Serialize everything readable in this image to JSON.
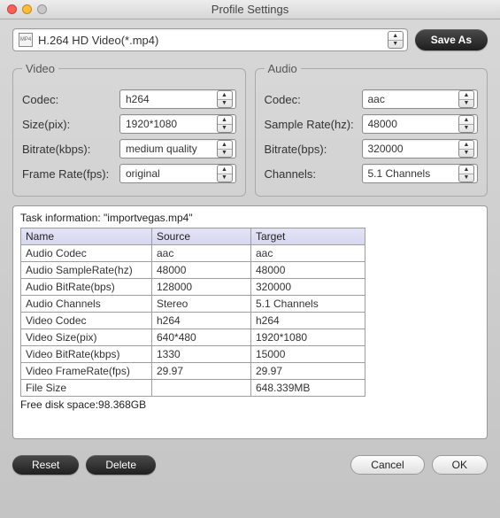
{
  "window": {
    "title": "Profile Settings"
  },
  "profile": {
    "label": "H.264 HD Video(*.mp4)",
    "icon_text": "MP4"
  },
  "buttons": {
    "save_as": "Save As",
    "reset": "Reset",
    "delete": "Delete",
    "cancel": "Cancel",
    "ok": "OK"
  },
  "video": {
    "legend": "Video",
    "codec_label": "Codec:",
    "codec_value": "h264",
    "size_label": "Size(pix):",
    "size_value": "1920*1080",
    "bitrate_label": "Bitrate(kbps):",
    "bitrate_value": "medium quality",
    "framerate_label": "Frame Rate(fps):",
    "framerate_value": "original"
  },
  "audio": {
    "legend": "Audio",
    "codec_label": "Codec:",
    "codec_value": "aac",
    "sample_label": "Sample Rate(hz):",
    "sample_value": "48000",
    "bitrate_label": "Bitrate(bps):",
    "bitrate_value": "320000",
    "channels_label": "Channels:",
    "channels_value": "5.1 Channels"
  },
  "task": {
    "header_prefix": "Task information: ",
    "filename": "\"importvegas.mp4\"",
    "columns": {
      "name": "Name",
      "source": "Source",
      "target": "Target"
    },
    "rows": [
      {
        "name": "Audio Codec",
        "source": "aac",
        "target": "aac"
      },
      {
        "name": "Audio SampleRate(hz)",
        "source": "48000",
        "target": "48000"
      },
      {
        "name": "Audio BitRate(bps)",
        "source": "128000",
        "target": "320000"
      },
      {
        "name": "Audio Channels",
        "source": "Stereo",
        "target": "5.1 Channels"
      },
      {
        "name": "Video Codec",
        "source": "h264",
        "target": "h264"
      },
      {
        "name": "Video Size(pix)",
        "source": "640*480",
        "target": "1920*1080"
      },
      {
        "name": "Video BitRate(kbps)",
        "source": "1330",
        "target": "15000"
      },
      {
        "name": "Video FrameRate(fps)",
        "source": "29.97",
        "target": "29.97"
      },
      {
        "name": "File Size",
        "source": "",
        "target": "648.339MB"
      }
    ],
    "freedisk_label": "Free disk space:",
    "freedisk_value": "98.368GB"
  }
}
